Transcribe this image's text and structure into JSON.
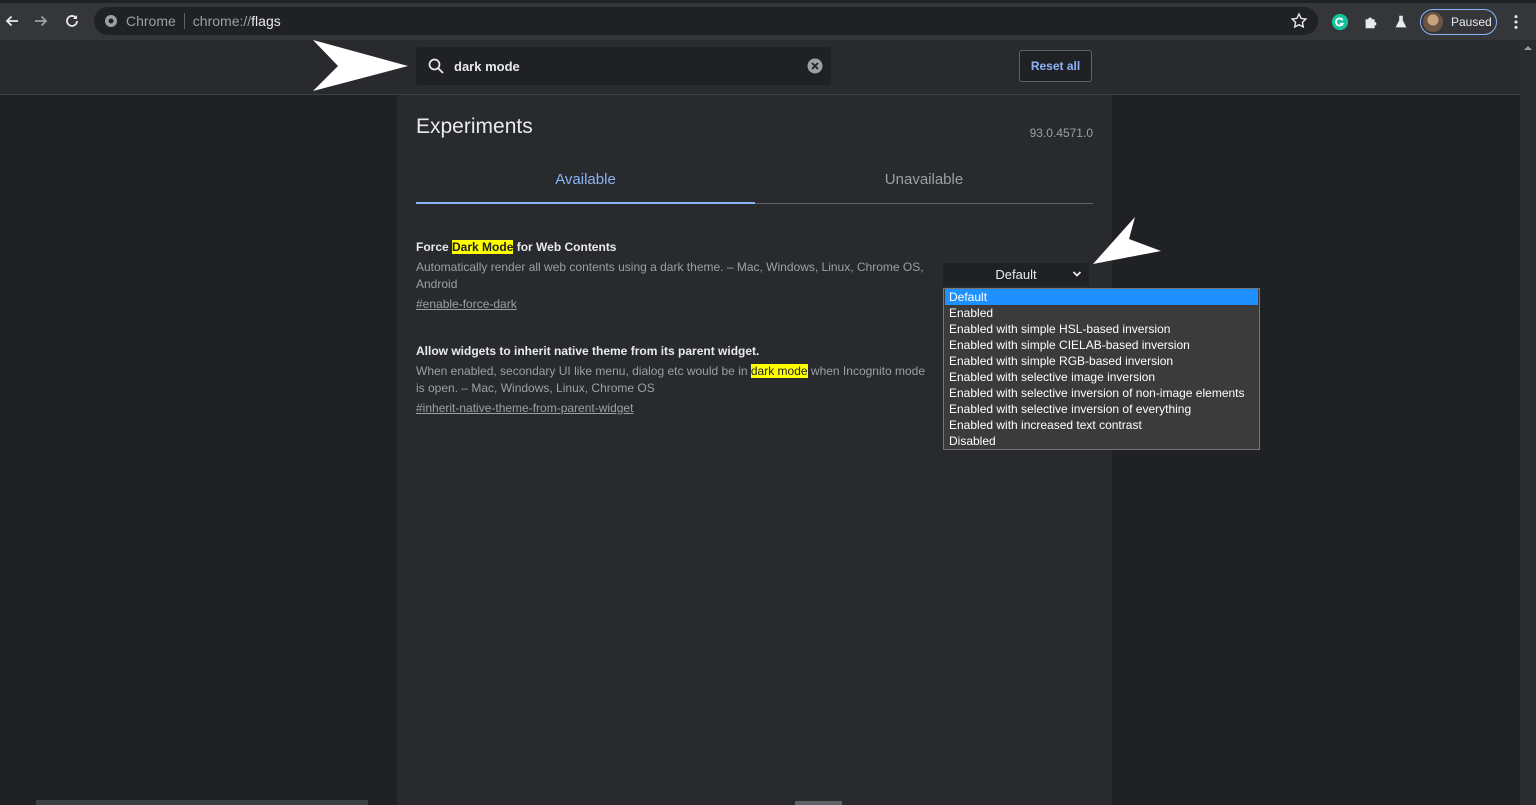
{
  "toolbar": {
    "site_name": "Chrome",
    "url_scheme": "chrome://",
    "url_path": "flags",
    "profile_label": "Paused"
  },
  "header": {
    "search_value": "dark mode",
    "reset_label": "Reset all"
  },
  "main": {
    "title": "Experiments",
    "version": "93.0.4571.0",
    "tabs": [
      {
        "label": "Available"
      },
      {
        "label": "Unavailable"
      }
    ],
    "experiments": [
      {
        "title_pre": "Force ",
        "title_hl": "Dark Mode",
        "title_post": " for Web Contents",
        "description": "Automatically render all web contents using a dark theme. – Mac, Windows, Linux, Chrome OS, Android",
        "link": "#enable-force-dark",
        "select_value": "Default"
      },
      {
        "title": "Allow widgets to inherit native theme from its parent widget.",
        "desc_pre": "When enabled, secondary UI like menu, dialog etc would be in ",
        "desc_hl": "dark mode",
        "desc_post": " when Incognito mode is open. – Mac, Windows, Linux, Chrome OS",
        "link": "#inherit-native-theme-from-parent-widget"
      }
    ]
  },
  "dropdown": {
    "options": [
      "Default",
      "Enabled",
      "Enabled with simple HSL-based inversion",
      "Enabled with simple CIELAB-based inversion",
      "Enabled with simple RGB-based inversion",
      "Enabled with selective image inversion",
      "Enabled with selective inversion of non-image elements",
      "Enabled with selective inversion of everything",
      "Enabled with increased text contrast",
      "Disabled"
    ],
    "selected_index": 0
  },
  "colors": {
    "accent": "#8ab4f8",
    "highlight": "#ffff00",
    "selected_option": "#1e90ff",
    "background": "#202124",
    "panel": "#292a2d"
  },
  "icons": [
    "back-icon",
    "forward-icon",
    "reload-icon",
    "chrome-logo-icon",
    "bookmark-star-icon",
    "grammarly-icon",
    "extensions-icon",
    "labs-icon",
    "avatar",
    "menu-dots-icon",
    "search-icon",
    "clear-icon",
    "chevron-down-icon"
  ]
}
